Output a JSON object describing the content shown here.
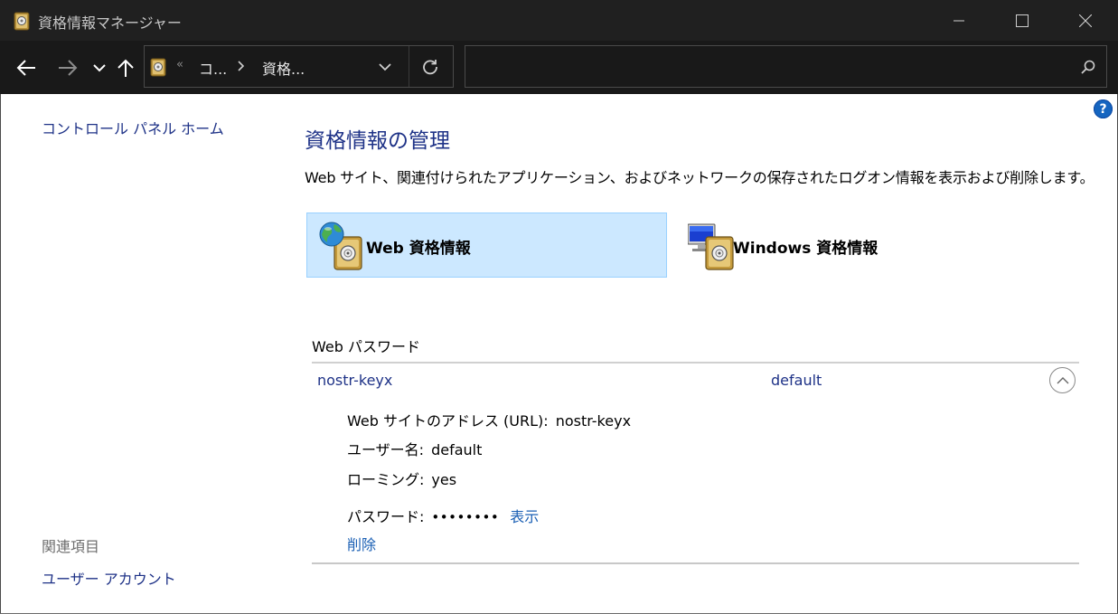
{
  "window": {
    "title": "資格情報マネージャー"
  },
  "address_bar": {
    "overflow_marker": "«",
    "breadcrumb_1": "コ...",
    "breadcrumb_2": "資格...",
    "search_placeholder": ""
  },
  "left_pane": {
    "home_link": "コントロール パネル ホーム",
    "related_heading": "関連項目",
    "user_accounts_link": "ユーザー アカウント"
  },
  "main": {
    "title": "資格情報の管理",
    "description": "Web サイト、関連付けられたアプリケーション、およびネットワークの保存されたログオン情報を表示および削除します。",
    "categories": [
      {
        "label": "Web 資格情報",
        "selected": true
      },
      {
        "label": "Windows 資格情報",
        "selected": false
      }
    ],
    "section_title": "Web パスワード",
    "credential": {
      "name": "nostr-keyx",
      "user": "default",
      "url_label": "Web サイトのアドレス (URL):",
      "url_value": "nostr-keyx",
      "username_label": "ユーザー名:",
      "username_value": "default",
      "roaming_label": "ローミング:",
      "roaming_value": "yes",
      "password_label": "パスワード:",
      "password_mask": "••••••••",
      "show_link": "表示",
      "delete_link": "削除"
    }
  },
  "help": {
    "glyph": "?"
  },
  "colors": {
    "titlebar": "#202020",
    "addressbar": "#191919",
    "link": "#1e3287",
    "action_link": "#1a5fb4",
    "selected_tile": "#cce8ff",
    "help": "#1565c0"
  }
}
